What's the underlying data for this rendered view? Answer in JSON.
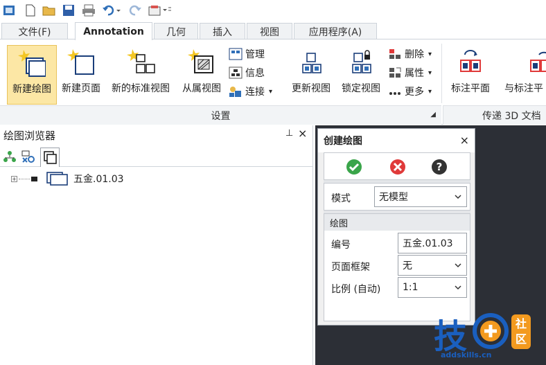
{
  "qat": {
    "icons": [
      "app-icon",
      "new-file-icon",
      "open-folder-icon",
      "save-icon",
      "print-icon",
      "undo-icon",
      "redo-icon",
      "customize-icon"
    ]
  },
  "tabs": [
    "文件(F)",
    "Annotation",
    "几何",
    "插入",
    "视图",
    "应用程序(A)"
  ],
  "ribbon": {
    "big_buttons": [
      "新建绘图",
      "新建页面",
      "新的标准视图",
      "从属视图",
      "更新视图",
      "锁定视图",
      "标注平面",
      "与标注平"
    ],
    "small_buttons": [
      "管理",
      "信息",
      "连接",
      "删除",
      "属性",
      "更多"
    ],
    "group_label": "设置",
    "group_label2": "传递 3D 文档"
  },
  "browser": {
    "title": "绘图浏览器",
    "pin": "ꟷ",
    "close": "×",
    "tree_item": "五金.01.03"
  },
  "dialog": {
    "title": "创建绘图",
    "close": "×",
    "mode_label": "模式",
    "mode_value": "无模型",
    "section": "绘图",
    "number_label": "编号",
    "number_value": "五金.01.03",
    "frame_label": "页面框架",
    "frame_value": "无",
    "scale_label": "比例 (自动)",
    "scale_value": "1:1"
  },
  "watermark": {
    "main": "技",
    "sub": "addskills.cn",
    "badge_top": "社",
    "badge_bottom": "区"
  },
  "colors": {
    "accent": "#2563b0",
    "ok": "#3aa54a",
    "cancel": "#e03a3a",
    "help": "#333333",
    "selected": "#fce7a5",
    "logo": "#1a5fbf",
    "logo_orange": "#f39a1f"
  }
}
